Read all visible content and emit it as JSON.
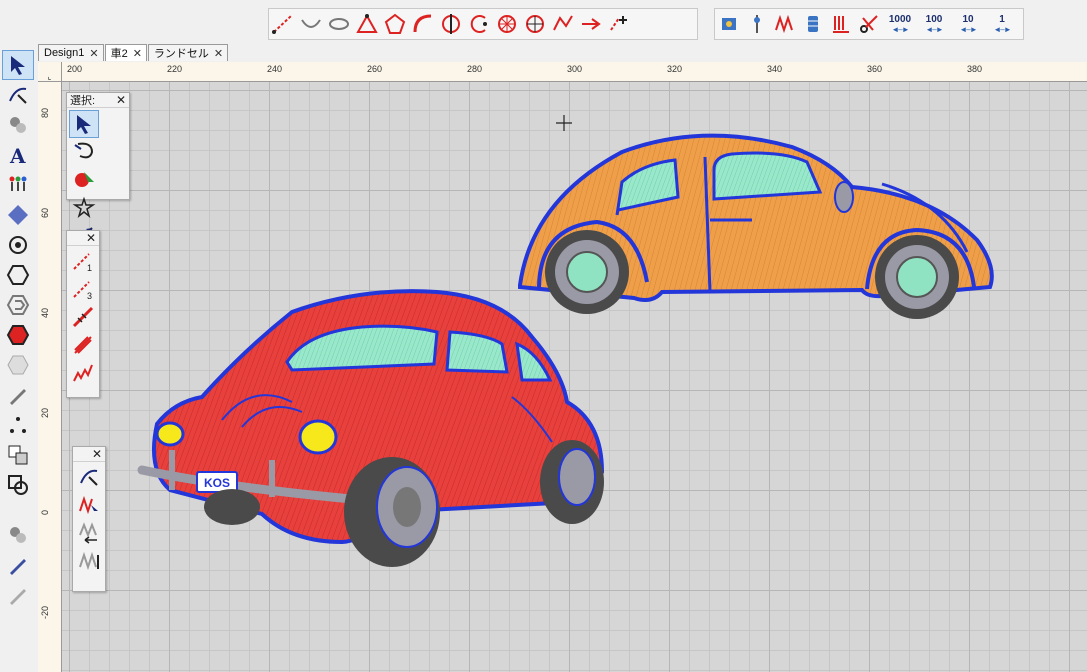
{
  "tabs": [
    {
      "label": "Design1",
      "active": false
    },
    {
      "label": "車2",
      "active": true
    },
    {
      "label": "ランドセル",
      "active": false
    }
  ],
  "tab_close_glyph": "✕",
  "toolbar_numbers": [
    "1000",
    "100",
    "10",
    "1"
  ],
  "ruler_top_labels": [
    "200",
    "220",
    "240",
    "260",
    "280",
    "300",
    "320",
    "340",
    "360",
    "380"
  ],
  "ruler_left_labels": [
    "80",
    "60",
    "40",
    "20",
    "0",
    "-20"
  ],
  "palettes": {
    "select": {
      "title": "選択:",
      "close": "✕"
    },
    "lines": {
      "close": "✕",
      "num1": "1",
      "num3": "3"
    },
    "stitch": {
      "close": "✕"
    }
  },
  "license_plate": "KOS",
  "colors": {
    "outline": "#2336d9",
    "red_body": "#e8403c",
    "orange_body": "#ef9f4a",
    "glass": "#8fe3c3",
    "tire": "#4a4a4a",
    "hub": "#9a9aa6",
    "headlight": "#f6e81a",
    "canvas_bg": "#d6d6d6"
  }
}
